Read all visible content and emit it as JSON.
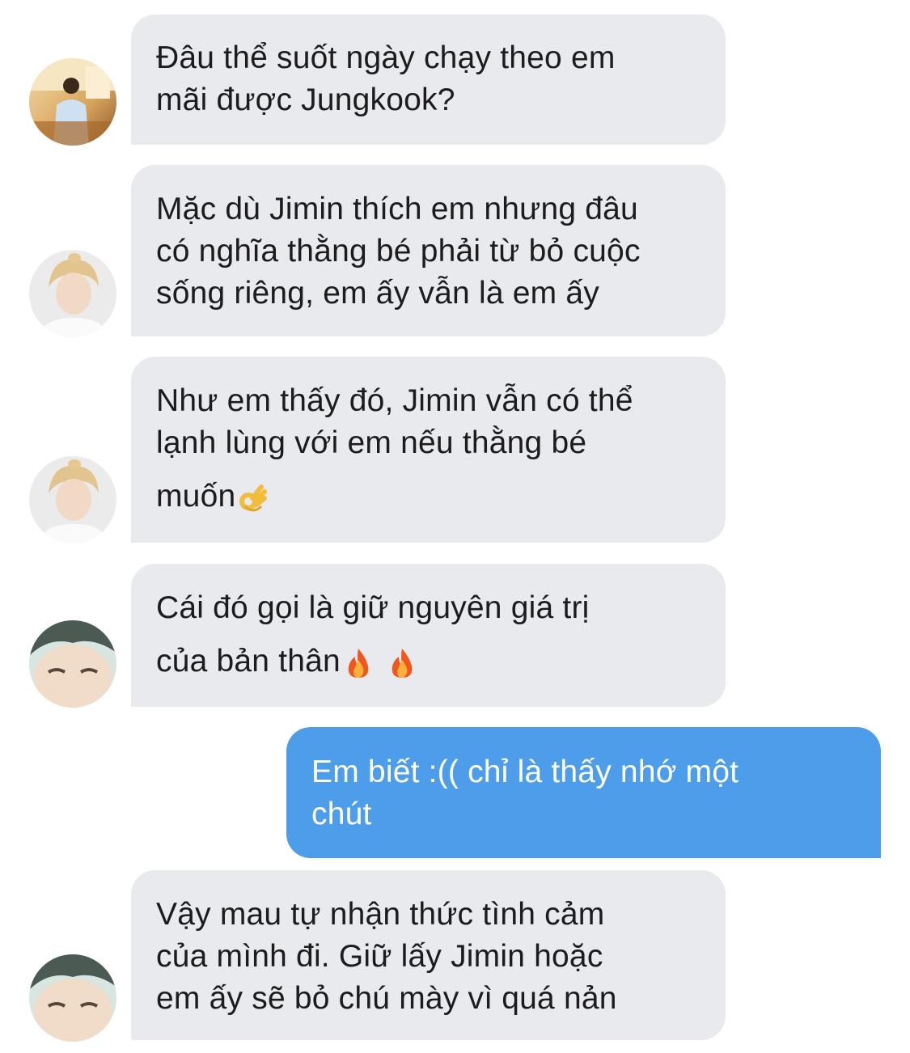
{
  "conversation": {
    "messages": [
      {
        "direction": "incoming",
        "avatar": "hyung-avatar-window",
        "lines": [
          "Đâu thể suốt ngày chạy theo em",
          "mãi được Jungkook?"
        ]
      },
      {
        "direction": "incoming",
        "avatar": "hyung-avatar-blond",
        "lines": [
          "Mặc dù Jimin thích em nhưng đâu",
          "có nghĩa thằng bé phải từ bỏ cuộc",
          "sống riêng, em ấy vẫn là em ấy"
        ]
      },
      {
        "direction": "incoming",
        "avatar": "hyung-avatar-blond",
        "lines": [
          "Như em thấy đó, Jimin vẫn có thể",
          "lạnh lùng với em nếu thằng bé",
          "muốn"
        ],
        "emoji": [
          "ok-hand-emoji"
        ]
      },
      {
        "direction": "incoming",
        "avatar": "hyung-avatar-closeup",
        "lines": [
          "Cái đó gọi là giữ nguyên giá trị",
          "của bản thân"
        ],
        "emoji": [
          "fire-emoji",
          "fire-emoji"
        ]
      },
      {
        "direction": "outgoing",
        "lines": [
          "Em biết :(( chỉ là thấy nhớ một",
          "chút"
        ]
      },
      {
        "direction": "incoming",
        "avatar": "hyung-avatar-closeup",
        "lines": [
          "Vậy mau tự nhận thức tình cảm",
          "của mình đi. Giữ lấy Jimin hoặc",
          "em ấy sẽ bỏ chú mày vì quá nản"
        ]
      }
    ]
  },
  "colors": {
    "incoming_bubble": "#e9eaee",
    "outgoing_bubble": "#4d9deb",
    "incoming_text": "#1c1c1e",
    "outgoing_text": "#ffffff"
  }
}
